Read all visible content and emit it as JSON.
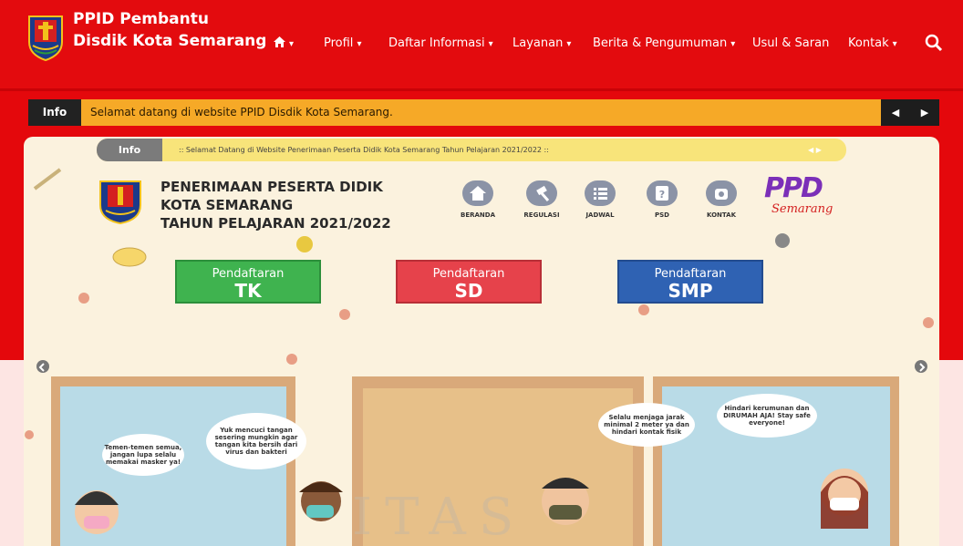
{
  "site": {
    "title_line1": "PPID Pembantu",
    "title_line2": "Disdik Kota Semarang"
  },
  "nav": {
    "home_caret": "▾",
    "items": [
      {
        "label": "Profil"
      },
      {
        "label": "Daftar Informasi"
      },
      {
        "label": "Layanan"
      },
      {
        "label": "Berita & Pengumuman"
      },
      {
        "label": "Usul & Saran"
      },
      {
        "label": "Kontak"
      }
    ]
  },
  "ticker": {
    "label": "Info",
    "text": "Selamat datang di website PPID Disdik Kota Semarang.",
    "prev": "◀",
    "next": "▶"
  },
  "slide": {
    "inner_ticker_label": "Info",
    "inner_ticker_text": ":: Selamat Datang di Website Penerimaan Peserta Didik Kota Semarang Tahun Pelajaran 2021/2022 ::",
    "inner_arrows": "◀ ▶",
    "title_line1": "PENERIMAAN PESERTA DIDIK",
    "title_line2": "KOTA SEMARANG",
    "title_line3": "TAHUN PELAJARAN 2021/2022",
    "icons": [
      {
        "label": "BERANDA"
      },
      {
        "label": "REGULASI"
      },
      {
        "label": "JADWAL"
      },
      {
        "label": "PSD"
      },
      {
        "label": "KONTAK"
      }
    ],
    "ppdb_logo_main": "PPD",
    "ppdb_logo_sub": "Semarang",
    "buttons": [
      {
        "top": "Pendaftaran",
        "bottom": "TK",
        "color": "#3fb34f"
      },
      {
        "top": "Pendaftaran",
        "bottom": "SD",
        "color": "#e6424b"
      },
      {
        "top": "Pendaftaran",
        "bottom": "SMP",
        "color": "#2f62b3"
      }
    ],
    "bubbles": [
      "Temen-temen semua, jangan lupa selalu memakai masker ya!",
      "Yuk mencuci tangan sesering mungkin agar tangan kita bersih dari virus dan bakteri",
      "Selalu menjaga jarak minimal 2 meter ya dan hindari kontak fisik",
      "Hindari kerumunan dan DIRUMAH AJA! Stay safe everyone!"
    ],
    "watermark": "ITAS"
  },
  "colors": {
    "brand_red": "#e30b0e",
    "ticker_orange": "#f6a927",
    "slide_cream": "#fbf2de"
  }
}
